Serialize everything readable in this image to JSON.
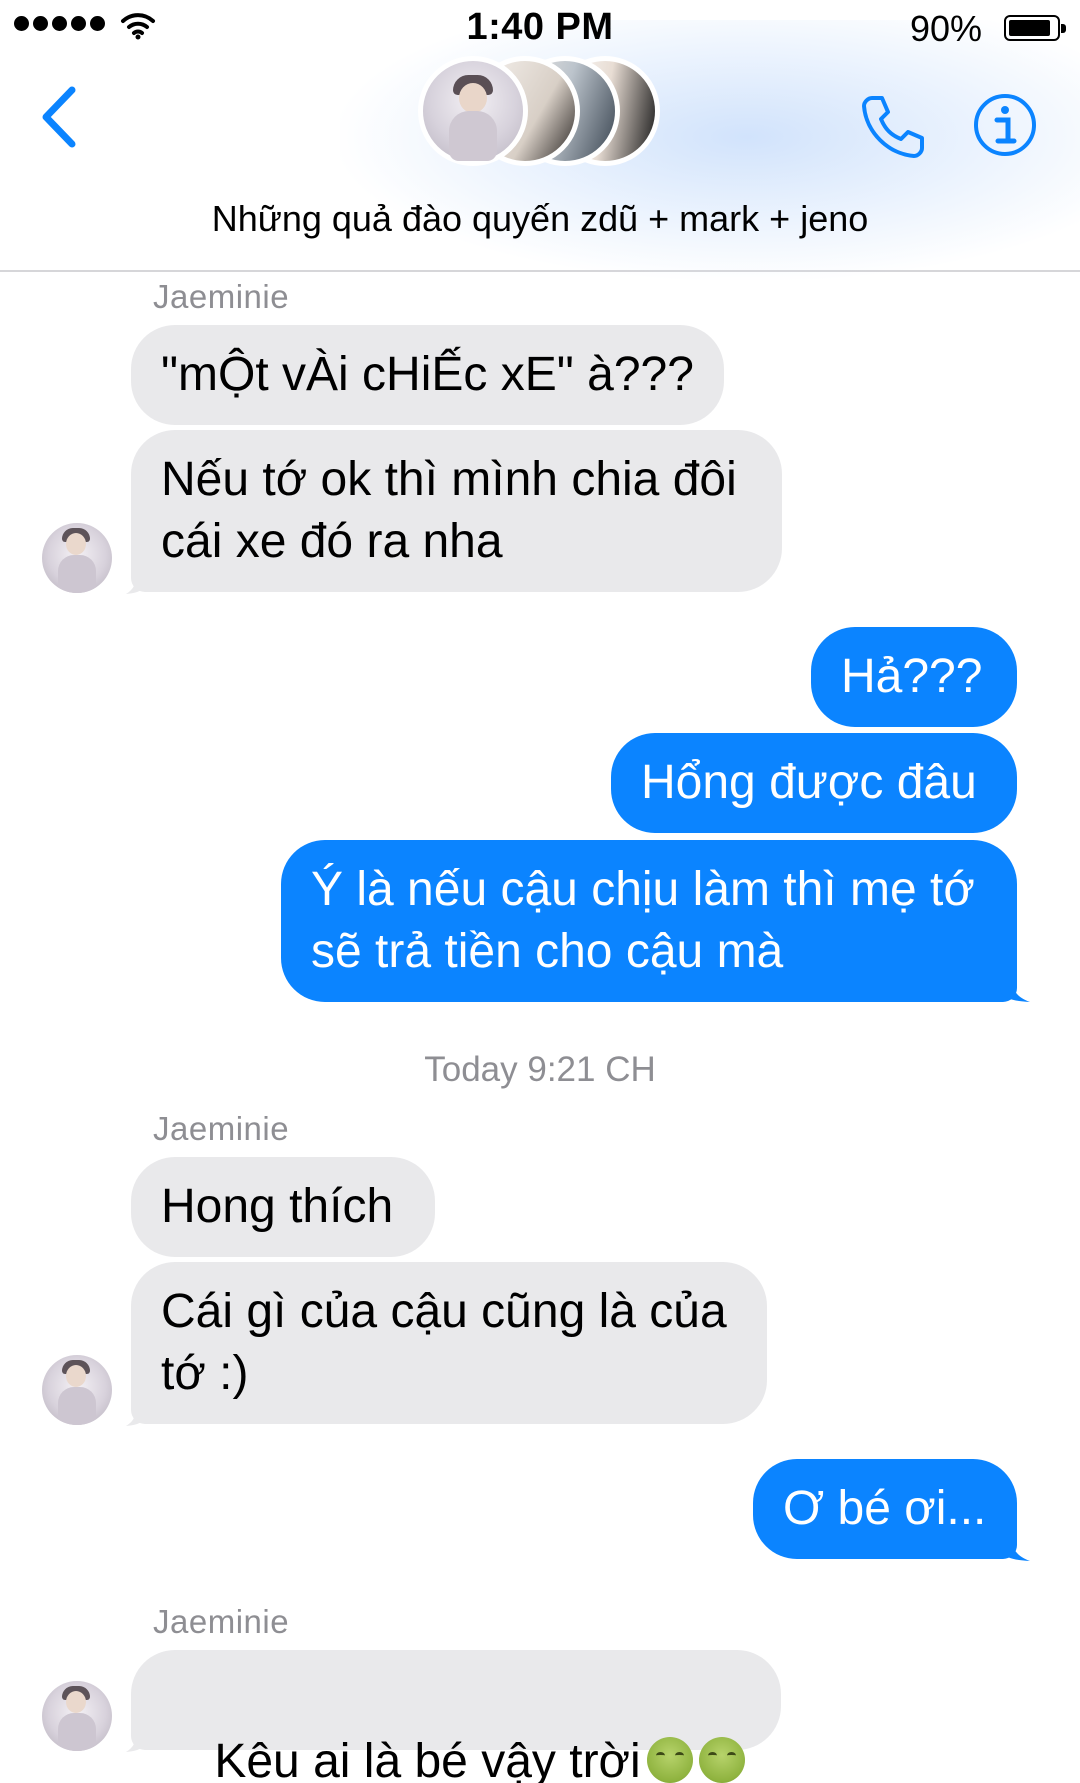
{
  "status_bar": {
    "time": "1:40 PM",
    "battery_percent": "90%",
    "battery_level": 0.9,
    "signal_icon": "signal-dots-icon",
    "wifi_icon": "wifi-icon"
  },
  "header": {
    "group_name": "Những quả đào quyến zdũ + mark + jeno",
    "back_icon": "chevron-left-icon",
    "call_icon": "phone-icon",
    "info_icon": "info-icon",
    "accent_color": "#0b84ff"
  },
  "messages": {
    "sender_1": "Jaeminie",
    "m1": "\"mỘt vÀi cHiẾc xE\" à???",
    "m2": "Nếu tớ ok thì mình chia đôi\ncái xe đó ra nha",
    "m3": "Hả???",
    "m4": "Hổng được đâu",
    "m5": "Ý là nếu cậu chịu làm thì mẹ tớ\nsẽ trả tiền cho cậu mà",
    "timestamp": "Today 9:21 CH",
    "sender_2": "Jaeminie",
    "m6": "Hong thích",
    "m7": "Cái gì của cậu cũng là của\ntớ :)",
    "m8": "Ơ bé ơi...",
    "sender_3": "Jaeminie",
    "m9": "Kêu ai là bé vậy trời",
    "m9_emoji": "nauseated-face-icon"
  },
  "colors": {
    "incoming_bubble": "#e9e9eb",
    "outgoing_bubble": "#0b84ff",
    "meta_text": "#8e8e93"
  }
}
